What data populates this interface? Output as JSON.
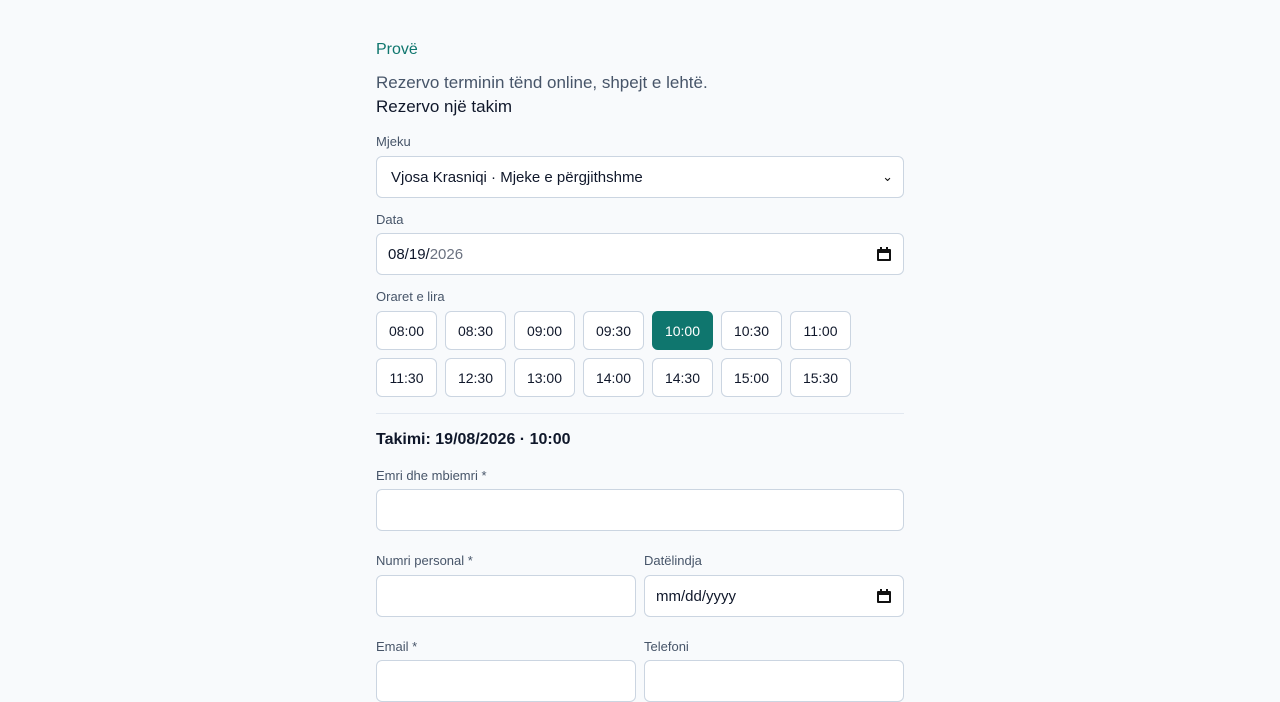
{
  "brand": "Provë",
  "tagline": "Rezervo terminin tënd online, shpejt e lehtë.",
  "heading": "Rezervo një takim",
  "doctor": {
    "label": "Mjeku",
    "selected": "Vjosa Krasniqi · Mjeke e përgjithshme"
  },
  "date": {
    "label": "Data",
    "value_entered": "08/19/",
    "value_pending": "2026"
  },
  "slots": {
    "label": "Oraret e lira",
    "times": [
      "08:00",
      "08:30",
      "09:00",
      "09:30",
      "10:00",
      "10:30",
      "11:00",
      "11:30",
      "12:30",
      "13:00",
      "14:00",
      "14:30",
      "15:00",
      "15:30"
    ],
    "selected": "10:00"
  },
  "summary": "Takimi: 19/08/2026 · 10:00",
  "form": {
    "name_label": "Emri dhe mbiemri *",
    "personal_id_label": "Numri personal *",
    "birthdate_label": "Datëlindja",
    "birthdate_placeholder": "mm/dd/yyyy",
    "email_label": "Email *",
    "phone_label": "Telefoni"
  },
  "colors": {
    "accent": "#0f766e",
    "background": "#f8fafc",
    "border": "#cbd5e1"
  }
}
